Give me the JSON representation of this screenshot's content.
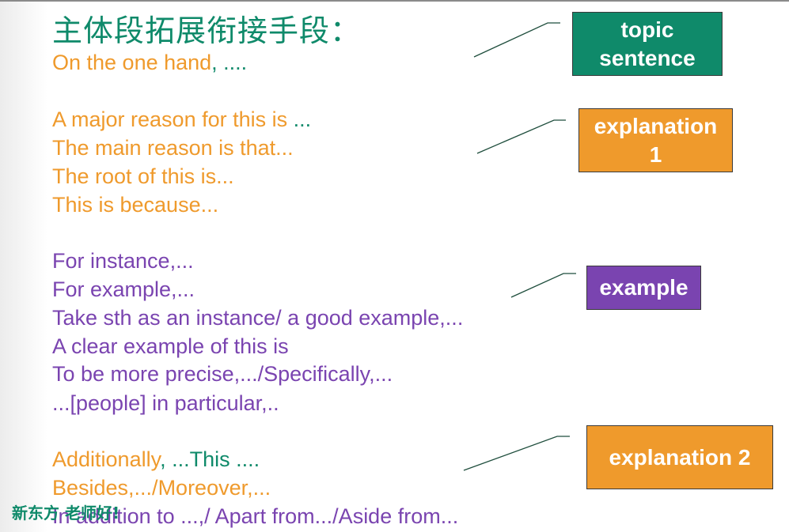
{
  "title": "主体段拓展衔接手段：",
  "lines": [
    {
      "parts": [
        {
          "text": "On the one hand",
          "color": "orange"
        },
        {
          "text": ", ....",
          "color": "teal"
        }
      ]
    },
    {
      "parts": [
        {
          "text": "A major reason for this is ",
          "color": "orange"
        },
        {
          "text": "...",
          "color": "teal"
        }
      ]
    },
    {
      "parts": [
        {
          "text": "The main reason is that...",
          "color": "orange"
        }
      ]
    },
    {
      "parts": [
        {
          "text": "The root of this is...",
          "color": "orange"
        }
      ]
    },
    {
      "parts": [
        {
          "text": "This is because...",
          "color": "orange"
        }
      ]
    },
    {
      "parts": [
        {
          "text": "For instance,...",
          "color": "purple"
        }
      ]
    },
    {
      "parts": [
        {
          "text": "For example,...",
          "color": "purple"
        }
      ]
    },
    {
      "parts": [
        {
          "text": "Take sth as an instance/ a good example,...",
          "color": "purple"
        }
      ]
    },
    {
      "parts": [
        {
          "text": "A clear example of this is",
          "color": "purple"
        }
      ]
    },
    {
      "parts": [
        {
          "text": "To be more precise,.../Specifically,...",
          "color": "purple"
        }
      ]
    },
    {
      "parts": [
        {
          "text": "...[people] in particular,..",
          "color": "purple"
        }
      ]
    },
    {
      "parts": [
        {
          "text": "Additionally",
          "color": "orange"
        },
        {
          "text": ", ...This ....",
          "color": "teal"
        }
      ]
    },
    {
      "parts": [
        {
          "text": "Besides,.../Moreover,...",
          "color": "orange"
        }
      ]
    },
    {
      "parts": [
        {
          "text": "In addition to ...,/ Apart from.../Aside from...",
          "color": "purple"
        }
      ]
    }
  ],
  "labels": {
    "topic": "topic\nsentence",
    "explanation1": "explanation\n1",
    "example": "example",
    "explanation2": "explanation 2"
  },
  "watermark": "新东方 老师好!",
  "colors": {
    "orange": "#ef9a2c",
    "teal": "#0f8a6a",
    "purple": "#7a44b0"
  }
}
